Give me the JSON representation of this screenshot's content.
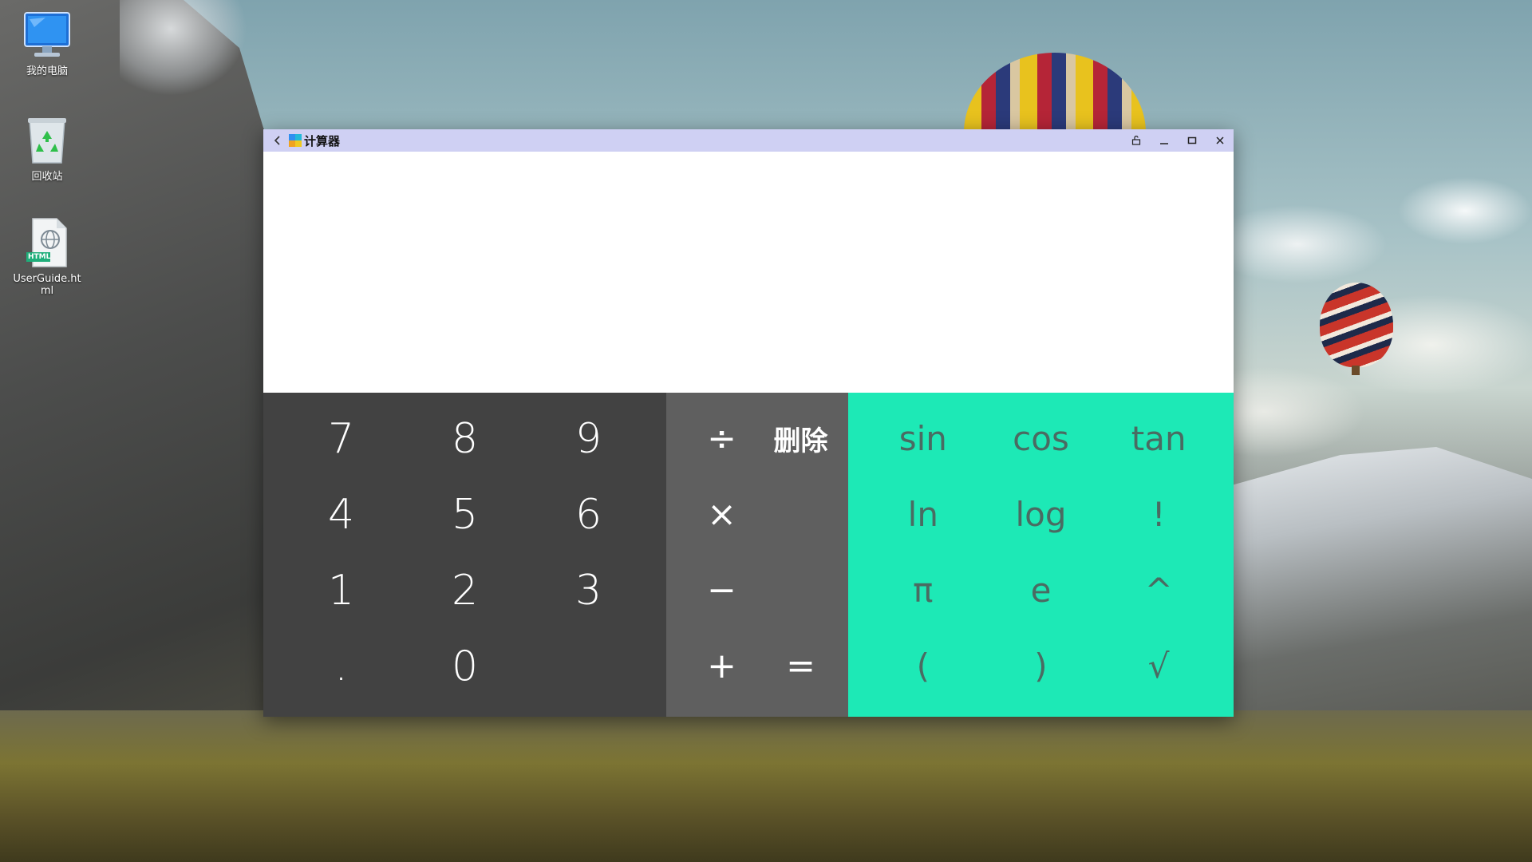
{
  "desktop": {
    "icons": [
      {
        "label": "我的电脑",
        "icon": "computer-icon"
      },
      {
        "label": "回收站",
        "icon": "recycle-bin-icon"
      },
      {
        "label": "UserGuide.html",
        "icon": "html-file-icon",
        "badge": "HTML"
      }
    ]
  },
  "window": {
    "title": "计算器",
    "back_icon": "chevron-left-icon",
    "app_icon": "calculator-app-icon",
    "controls": [
      {
        "name": "pin-icon"
      },
      {
        "name": "minimize-icon"
      },
      {
        "name": "maximize-icon"
      },
      {
        "name": "close-icon"
      }
    ]
  },
  "calculator": {
    "display_value": "",
    "numpad": [
      "7",
      "8",
      "9",
      "4",
      "5",
      "6",
      "1",
      "2",
      "3",
      ".",
      "0",
      ""
    ],
    "operators": {
      "divide": "÷",
      "delete": "删除",
      "multiply": "×",
      "minus": "−",
      "plus": "+",
      "equals": "="
    },
    "advanced": [
      "sin",
      "cos",
      "tan",
      "ln",
      "log",
      "!",
      "π",
      "e",
      "^",
      "(",
      ")",
      "√"
    ]
  },
  "colors": {
    "titlebar": "#cfd0f3",
    "numpad_bg": "#424242",
    "operator_bg": "#5f5f5f",
    "advanced_bg": "#1de9b6",
    "advanced_text": "#4a6b62"
  }
}
